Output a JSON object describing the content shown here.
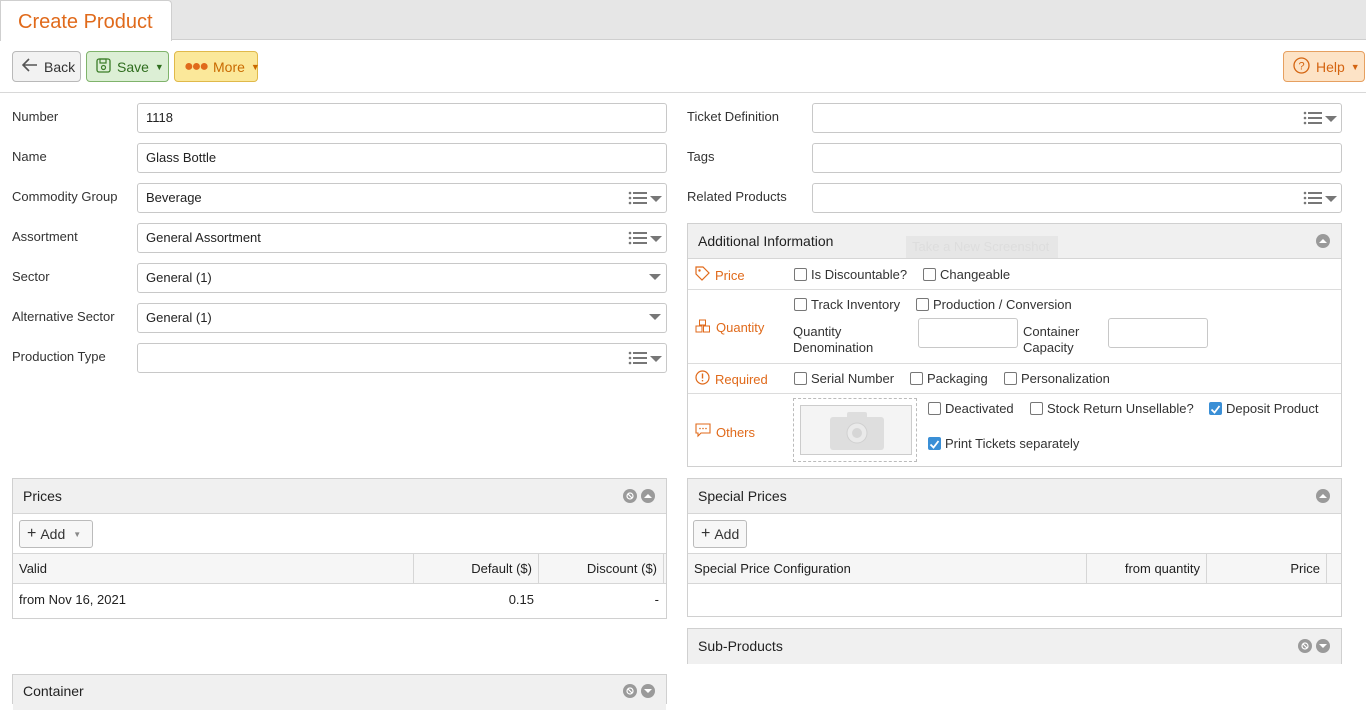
{
  "tabs": {
    "active_label": "Create Product"
  },
  "toolbar": {
    "back_label": "Back",
    "save_label": "Save",
    "more_label": "More",
    "help_label": "Help"
  },
  "form_left": [
    {
      "label": "Number",
      "value": "1118",
      "kind": "text"
    },
    {
      "label": "Name",
      "value": "Glass Bottle",
      "kind": "text"
    },
    {
      "label": "Commodity Group",
      "value": "Beverage",
      "kind": "list"
    },
    {
      "label": "Assortment",
      "value": "General Assortment",
      "kind": "list"
    },
    {
      "label": "Sector",
      "value": "General (1)",
      "kind": "select"
    },
    {
      "label": "Alternative Sector",
      "value": "General (1)",
      "kind": "select"
    },
    {
      "label": "Production Type",
      "value": "",
      "kind": "list"
    }
  ],
  "form_right": [
    {
      "label": "Ticket Definition",
      "value": "",
      "kind": "list"
    },
    {
      "label": "Tags",
      "value": "",
      "kind": "text"
    },
    {
      "label": "Related Products",
      "value": "",
      "kind": "list"
    }
  ],
  "additional_info": {
    "title": "Additional Information",
    "price": {
      "label": "Price",
      "is_discountable": {
        "label": "Is Discountable?",
        "checked": false
      },
      "changeable": {
        "label": "Changeable",
        "checked": false
      }
    },
    "quantity": {
      "label": "Quantity",
      "track_inventory": {
        "label": "Track Inventory",
        "checked": false
      },
      "production_conversion": {
        "label": "Production / Conversion",
        "checked": false
      },
      "quantity_denomination_label_1": "Quantity",
      "quantity_denomination_label_2": "Denomination",
      "container_capacity_label_1": "Container",
      "container_capacity_label_2": "Capacity"
    },
    "required": {
      "label": "Required",
      "serial_number": {
        "label": "Serial Number",
        "checked": false
      },
      "packaging": {
        "label": "Packaging",
        "checked": false
      },
      "personalization": {
        "label": "Personalization",
        "checked": false
      }
    },
    "others": {
      "label": "Others",
      "deactivated": {
        "label": "Deactivated",
        "checked": false
      },
      "stock_return_unsellable": {
        "label": "Stock Return Unsellable?",
        "checked": false
      },
      "deposit_product": {
        "label": "Deposit Product",
        "checked": true
      },
      "print_tickets_separately": {
        "label": "Print Tickets separately",
        "checked": true
      }
    },
    "overlay_text": "Take a New Screenshot"
  },
  "prices": {
    "title": "Prices",
    "add_label": "Add",
    "columns": [
      "Valid",
      "Default ($)",
      "Discount ($)"
    ],
    "rows": [
      {
        "valid": "from Nov 16, 2021",
        "default": "0.15",
        "discount": "-"
      }
    ]
  },
  "special_prices": {
    "title": "Special Prices",
    "add_label": "Add",
    "columns": [
      "Special Price Configuration",
      "from quantity",
      "Price"
    ]
  },
  "sub_products": {
    "title": "Sub-Products"
  },
  "container": {
    "title": "Container"
  },
  "colors": {
    "accent": "#e06a1b",
    "save_bg": "#dcefd5",
    "more_bg": "#fbe89a",
    "help_bg": "#fde3c6",
    "checkbox_checked": "#3a8fd6"
  }
}
